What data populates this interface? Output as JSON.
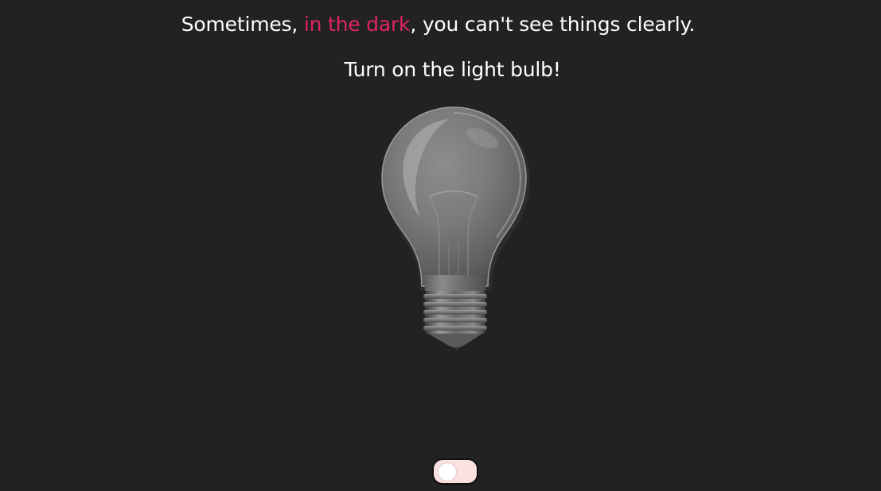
{
  "headline": {
    "before": "Sometimes, ",
    "highlight": "in the dark",
    "after": ", you can't see things clearly."
  },
  "subline": "Turn on the light bulb!",
  "bulb": {
    "state": "off",
    "icon": "light-bulb-icon"
  },
  "toggle": {
    "checked": false
  },
  "colors": {
    "background": "#222222",
    "highlight": "#e0245e",
    "toggle_track": "#fbe1e1"
  }
}
